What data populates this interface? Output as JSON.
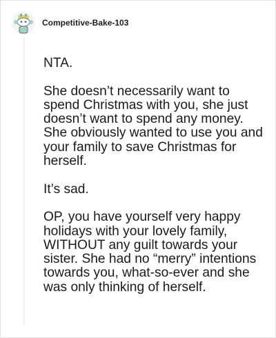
{
  "comment": {
    "author": "Competitive-Bake-103",
    "avatar_icon": "snoo-avatar-icon",
    "paragraphs": [
      "NTA.",
      "She doesn’t necessarily want to spend Christmas with you, she just doesn’t want to spend any money. She obviously wanted to use you and your family to save Christmas for herself.",
      "It’s sad.",
      "OP, you have yourself very happy holidays with your lovely family, WITHOUT any guilt towards your sister. She had no “merry” intentions towards you, what-so-ever and she was only thinking of herself."
    ]
  },
  "colors": {
    "text": "#1a1a1b",
    "border": "#e2e2e2",
    "thread_line": "#edeff1",
    "avatar_bg": "#f4f4f6"
  }
}
